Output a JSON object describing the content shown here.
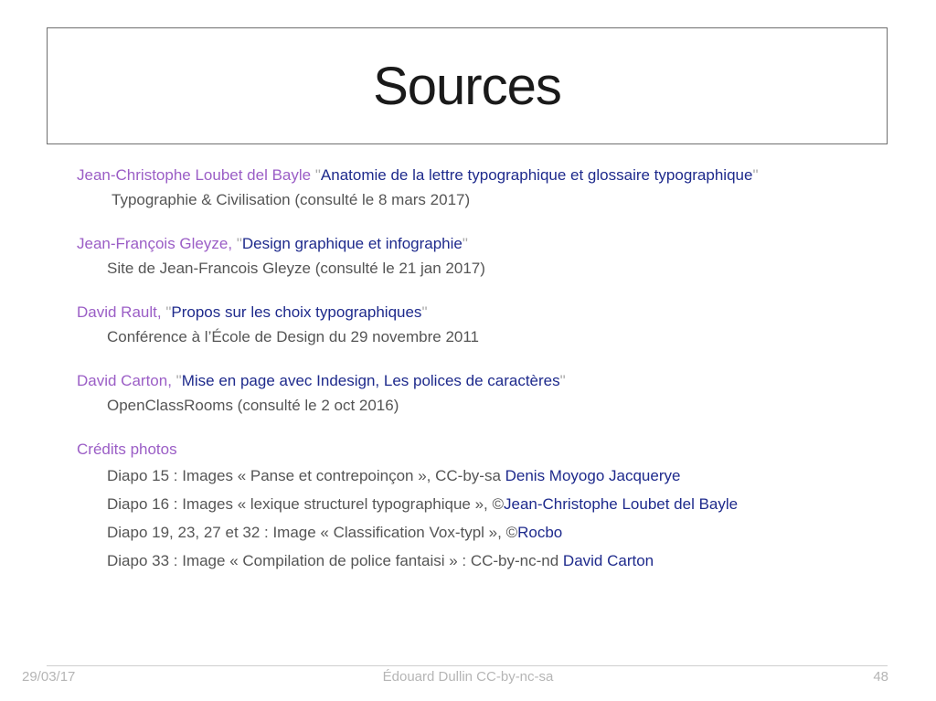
{
  "slide": {
    "title": "Sources",
    "sources": [
      {
        "author": "Jean-Christophe Loubet del Bayle",
        "title": "Anatomie de la lettre typographique et glossaire typographique",
        "detail": "Typographie & Civilisation (consulté le 8 mars 2017)"
      },
      {
        "author": "Jean-François Gleyze,",
        "title": "Design graphique et infographie",
        "detail": "Site de Jean-Francois Gleyze (consulté le 21 jan 2017)"
      },
      {
        "author": "David Rault,",
        "title": "Propos sur les choix typographiques",
        "detail": "Conférence à l’École de Design du 29 novembre 2011"
      },
      {
        "author": "David Carton,",
        "title": "Mise en page avec Indesign, Les polices de caractères",
        "detail": "OpenClassRooms (consulté le 2 oct 2016)"
      }
    ],
    "credits": {
      "heading": "Crédits photos",
      "items": [
        {
          "text": "Diapo 15 : Images « Panse et contrepoinçon », CC-by-sa ",
          "link": "Denis Moyogo Jacquerye"
        },
        {
          "text": "Diapo 16 : Images « lexique structurel typographique », ©",
          "link": "Jean-Christophe Loubet del Bayle"
        },
        {
          "text": "Diapo 19, 23, 27 et 32 : Image « Classification Vox-typl », ©",
          "link": "Rocbo"
        },
        {
          "text": "Diapo 33 : Image « Compilation de police fantaisi » : CC-by-nc-nd ",
          "link": "David Carton"
        }
      ]
    }
  },
  "footer": {
    "date": "29/03/17",
    "author": "Édouard Dullin CC-by-nc-sa",
    "page": "48"
  },
  "colors": {
    "author": "#9b5ec6",
    "title_link": "#1e2a8c",
    "detail": "#555555",
    "footer": "#b5b5b5"
  }
}
